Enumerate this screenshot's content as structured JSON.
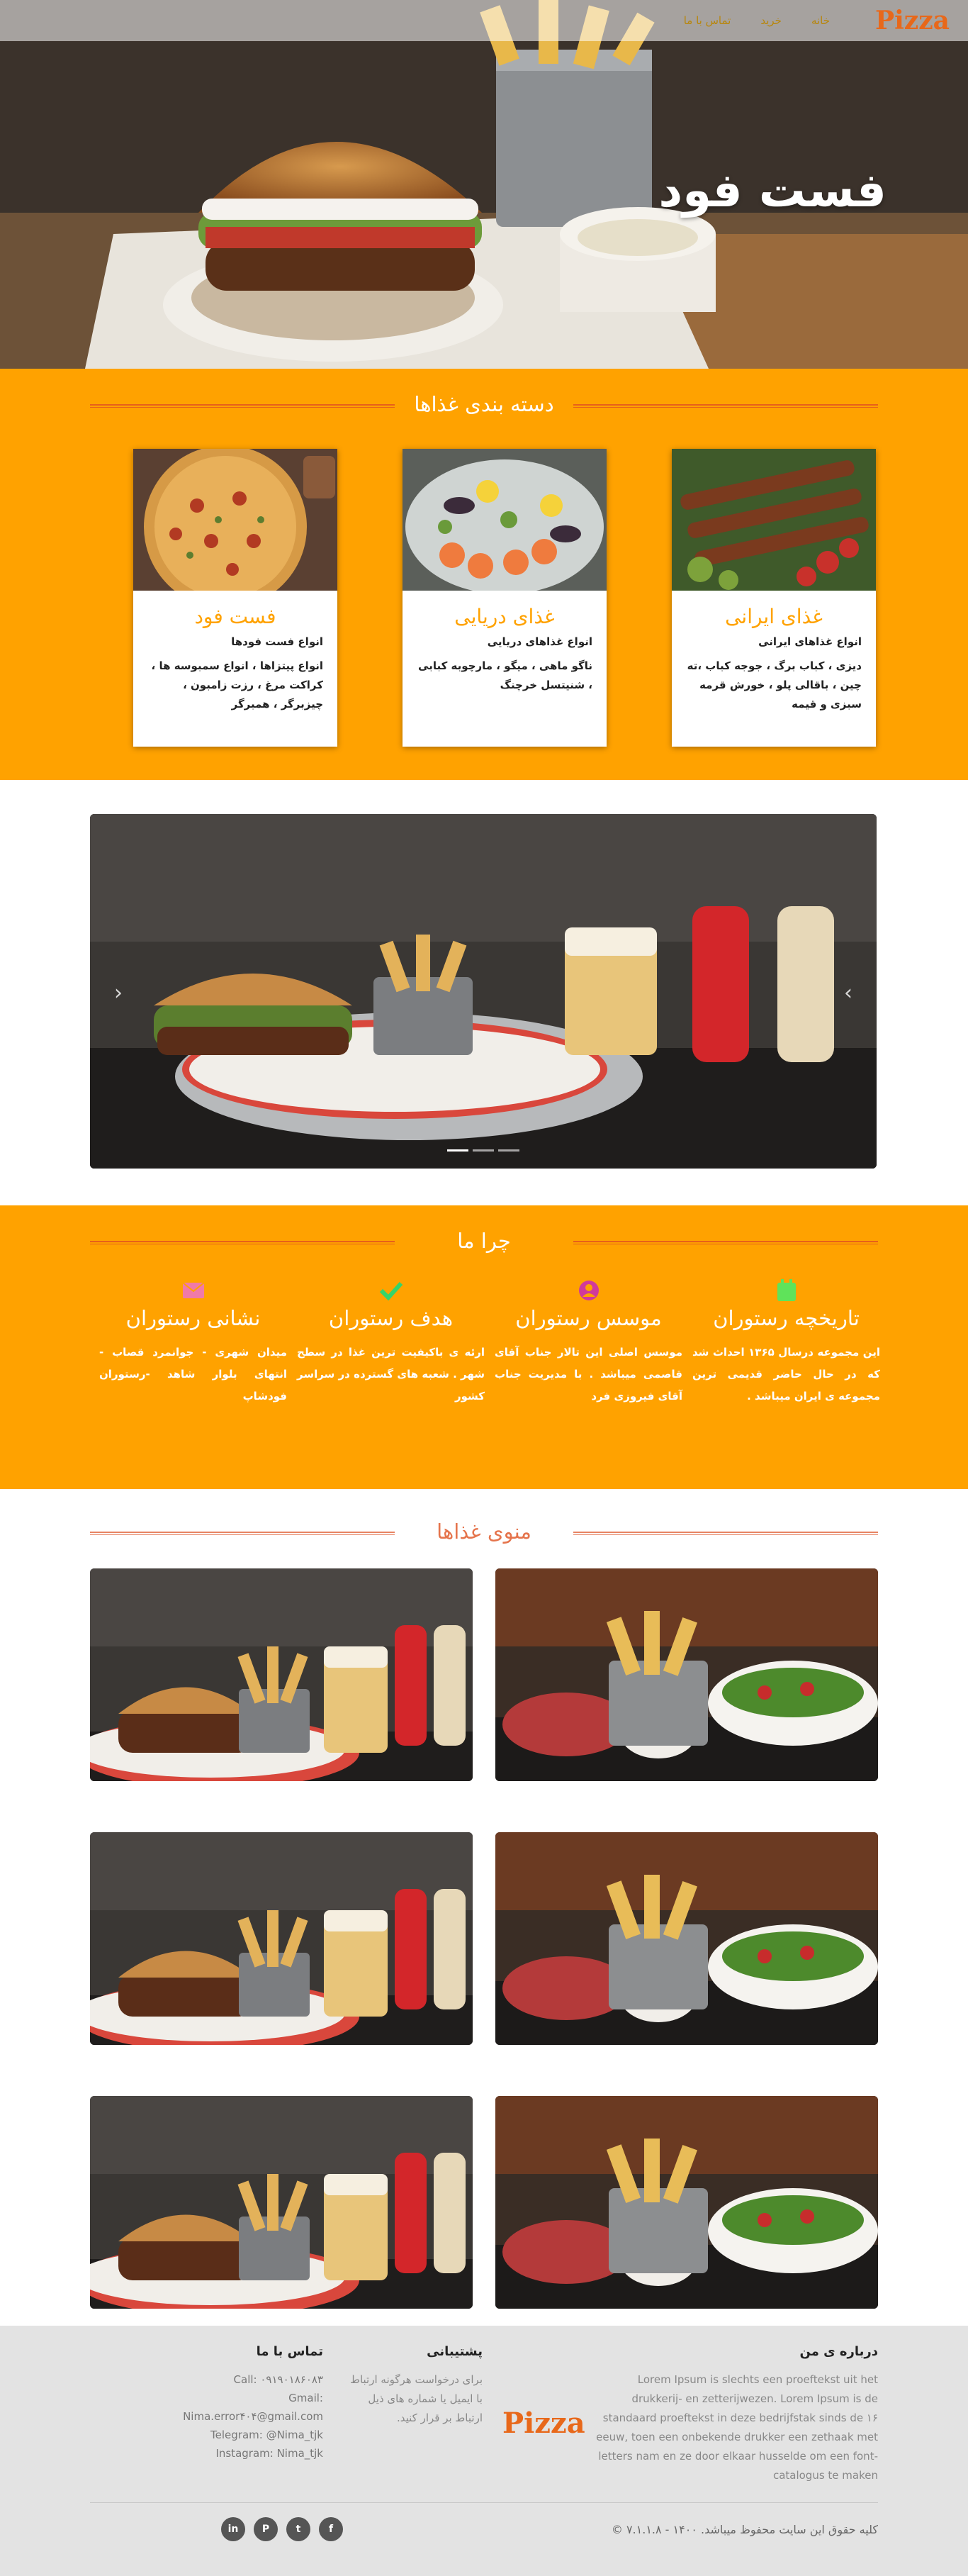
{
  "nav": {
    "brand": "Pizza",
    "links": [
      "خانه",
      "خرید",
      "تماس با ما"
    ]
  },
  "hero": {
    "title": "فست فود"
  },
  "categories": {
    "title": "دسته بندی غذاها",
    "cards": [
      {
        "title": "غذای ایرانی",
        "subtitle": "انواع غذاهای ایرانی",
        "text": "دیزی ، کباب برگ ، جوجه کباب ،ته چین ، باقالی پلو ، خورش قرمه سبزی و قیمه"
      },
      {
        "title": "غذای دریایی",
        "subtitle": "انواع غذاهای دریایی",
        "text": "ناگو ماهی ، میگو ، مارچوبه کبابی ، شنیتسل خرچنگ"
      },
      {
        "title": "فست فود",
        "subtitle": "انواع فست فودها",
        "text": "انواع پیتزاها ، انواع سمبوسه ها ، کراکت مرغ ، رزت زامبون ، چیزبرگر ، همبرگر"
      }
    ]
  },
  "why": {
    "title": "چرا ما",
    "features": [
      {
        "icon": "calendar-icon",
        "title": "تاریخچه رستوران",
        "text": "این مجموعه درسال ۱۳۶۵ احداث شد که در حال حاضر قدیمی ترین مجموعه ی ایران میباشد ."
      },
      {
        "icon": "user-icon",
        "title": "موسس رستوران",
        "text": "موسس اصلی این تالار جناب آقای قاصمی میباشد . با مدیریت جناب آقای فیروزی فرد"
      },
      {
        "icon": "check-icon",
        "title": "هدف رستوران",
        "text": "ارئه ی باکیفیت ترین غذا در سطح شهر . شعبه های گسترده در سراسر کشور"
      },
      {
        "icon": "envelope-icon",
        "title": "نشانی رستوران",
        "text": "میدان شهری - جوانمرد قصاب - انتهای بلوار شاهد -رستوران فودشاپ"
      }
    ]
  },
  "menu": {
    "title": "منوی غذاها"
  },
  "footer": {
    "about_title": "درباره ی من",
    "about_text": "Lorem Ipsum is slechts een proeftekst uit het drukkerij- en zetterijwezen. Lorem Ipsum is de standaard proeftekst in deze bedrijfstak sinds de ۱۶ eeuw, toen een onbekende drukker een zethaak met letters nam en ze door elkaar husselde om een font-catalogus te maken",
    "brand": "Pizza",
    "support_title": "پشتیبانی",
    "support_text": "برای درخواست هرگونه ارتباط با ایمیل یا شماره های ذیل ارتباط بر قرار کنید.",
    "contact_title": "تماس با ما",
    "contact_lines": [
      "Call: ۰۹۱۹۰۱۸۶۰۸۳",
      "Gmail: Nima.error۴۰۴@gmail.com",
      "Telegram: @Nima_tjk",
      "Instagram: Nima_tjk"
    ],
    "copyright": "کلیه حقوق این سایت محفوظ میباشد. ۱۴۰۰ - ۷.۱.۱.۸ ©",
    "socials": [
      "linkedin-icon",
      "pinterest-icon",
      "twitter-icon",
      "facebook-icon"
    ]
  },
  "colors": {
    "accent": "#ffa200",
    "brand": "#e8681a",
    "footer_bg": "#e3e3e3"
  }
}
